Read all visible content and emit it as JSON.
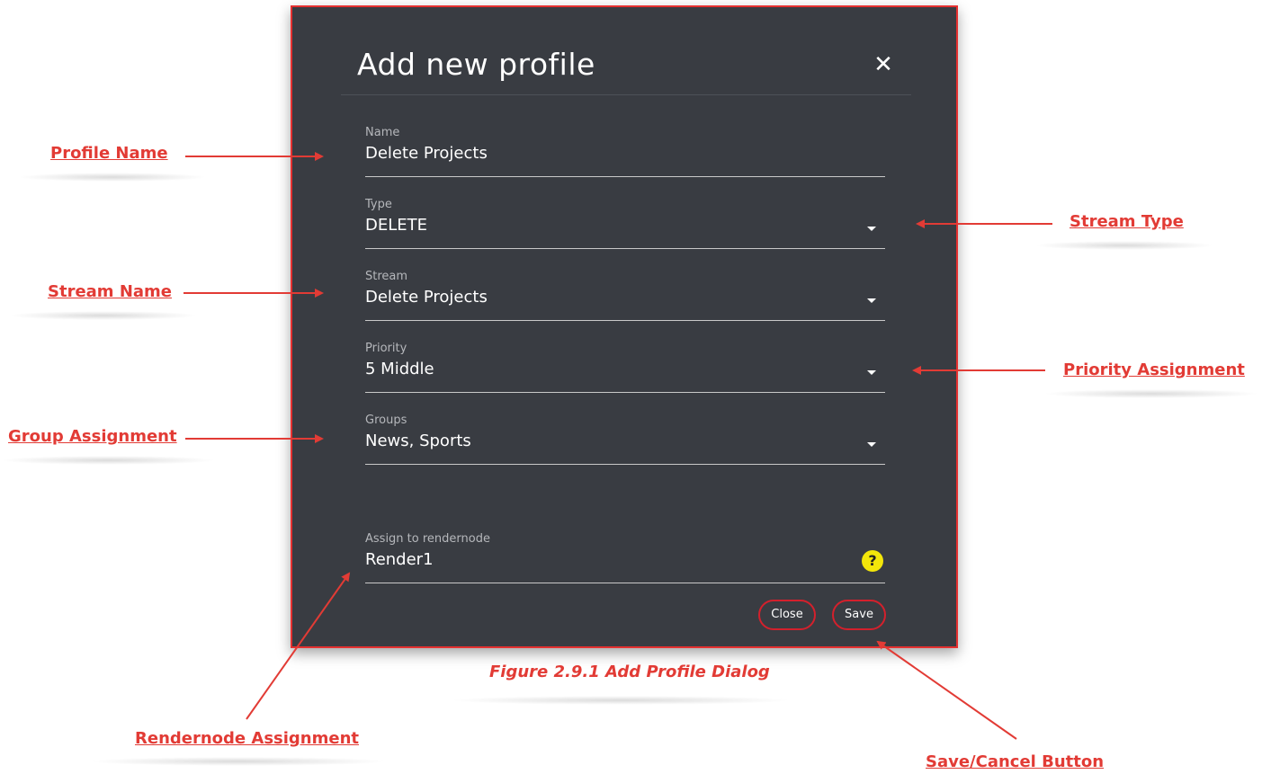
{
  "dialog": {
    "title": "Add new profile",
    "close_icon": "close-icon",
    "fields": {
      "name": {
        "label": "Name",
        "value": "Delete Projects"
      },
      "type": {
        "label": "Type",
        "value": "DELETE"
      },
      "stream": {
        "label": "Stream",
        "value": "Delete Projects"
      },
      "priority": {
        "label": "Priority",
        "value": "5 Middle"
      },
      "groups": {
        "label": "Groups",
        "value": "News, Sports"
      },
      "rendernode": {
        "label": "Assign to rendernode",
        "value": "Render1"
      }
    },
    "buttons": {
      "close": "Close",
      "save": "Save"
    }
  },
  "annotations": {
    "profile_name": "Profile Name",
    "stream_type": "Stream Type",
    "stream_name": "Stream Name",
    "priority_assignment": "Priority Assignment",
    "group_assignment": "Group Assignment",
    "rendernode_assignment": "Rendernode Assignment",
    "save_cancel": "Save/Cancel Button"
  },
  "caption": "Figure 2.9.1 Add Profile Dialog",
  "colors": {
    "annotation": "#e23b35",
    "dialog_bg": "#393c42",
    "accent_border": "#d4202c",
    "help_icon": "#f3e60a"
  }
}
